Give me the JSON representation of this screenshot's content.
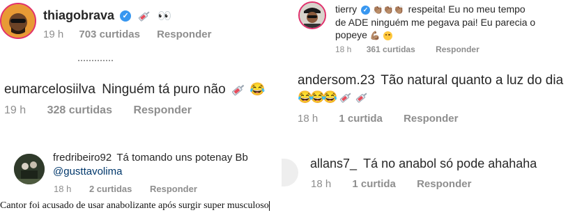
{
  "comments": [
    {
      "username": "thiagobrava",
      "text": "",
      "time": "19 h",
      "likes": "703 curtidas",
      "reply": "Responder",
      "verified": true,
      "emojis": [
        "syringe",
        "eyes"
      ]
    },
    {
      "username": "eumarcelosiilva",
      "text": "Ninguém tá puro não",
      "time": "19 h",
      "likes": "328 curtidas",
      "reply": "Responder",
      "emojis": [
        "syringe",
        "joy"
      ]
    },
    {
      "username": "fredribeiro92",
      "text": "Tá tomando uns potenay Bb",
      "mention": "@gusttavolima",
      "time": "18 h",
      "likes": "2 curtidas",
      "reply": "Responder"
    },
    {
      "username": "tierry",
      "verified": true,
      "text_line1": "respeita! Eu no meu tempo",
      "text_line2": "de ADE ninguém me pegava pai! Eu parecia o",
      "text_line3": "popeye",
      "time": "18 h",
      "likes": "361 curtidas",
      "reply": "Responder",
      "emojis": [
        "clap",
        "clap",
        "clap",
        "muscle",
        "shy"
      ]
    },
    {
      "username": "andersom.23",
      "text": "Tão natural quanto a luz do dia",
      "time": "18 h",
      "likes": "1 curtida",
      "reply": "Responder",
      "emojis": [
        "joy",
        "joy",
        "joy",
        "syringe",
        "syringe"
      ]
    },
    {
      "username": "allans7_",
      "text": "Tá no anabol só pode ahahaha",
      "time": "18 h",
      "likes": "1 curtida",
      "reply": "Responder"
    }
  ],
  "caption": "Cantor foi acusado de usar anabolizante após surgir super musculoso",
  "colors": {
    "text": "#262626",
    "meta": "#8e8e8e",
    "link": "#00376b",
    "verified": "#3897f0"
  }
}
